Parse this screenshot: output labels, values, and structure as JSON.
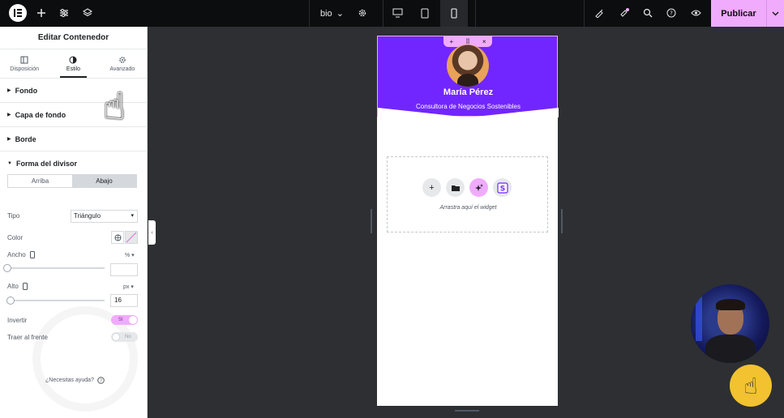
{
  "topbar": {
    "page_name": "bio",
    "publish_label": "Publicar",
    "accent": "#f0abfc"
  },
  "panel": {
    "title": "Editar Contenedor",
    "tabs": [
      {
        "label": "Disposición",
        "icon": "layout-icon"
      },
      {
        "label": "Estilo",
        "icon": "style-icon",
        "active": true
      },
      {
        "label": "Avanzado",
        "icon": "gear-icon"
      }
    ],
    "sections": [
      "Fondo",
      "Capa de fondo",
      "Borde"
    ],
    "divider": {
      "title": "Forma del divisor",
      "segment_top": "Arriba",
      "segment_bottom": "Abajo",
      "type_label": "Tipo",
      "type_value": "Triángulo",
      "color_label": "Color",
      "width_label": "Ancho",
      "width_unit": "%",
      "height_label": "Alto",
      "height_unit": "px",
      "height_value": "16",
      "invert_label": "Invertir",
      "invert_value": "Sí",
      "front_label": "Traer al frente",
      "front_value": "No"
    },
    "help_label": "¿Necesitas ayuda?"
  },
  "canvas": {
    "name": "María Pérez",
    "subtitle": "Consultora de Negocios Sostenibles",
    "hero_color": "#7126ff",
    "dropzone_text": "Arrastra aquí el widget"
  }
}
